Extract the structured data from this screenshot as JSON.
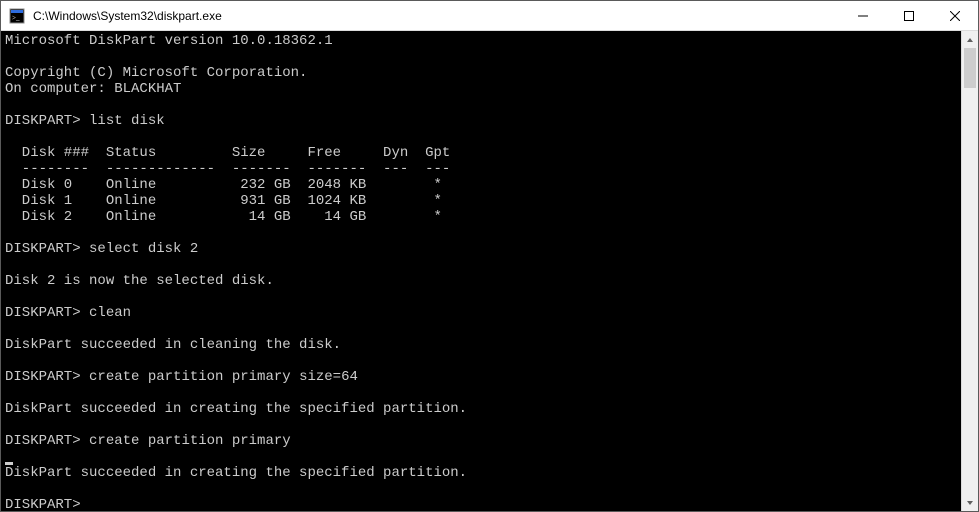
{
  "window": {
    "title": "C:\\Windows\\System32\\diskpart.exe"
  },
  "terminal": {
    "version_line": "Microsoft DiskPart version 10.0.18362.1",
    "copyright": "Copyright (C) Microsoft Corporation.",
    "computer_line": "On computer: BLACKHAT",
    "prompt": "DISKPART>",
    "cmd_list_disk": "list disk",
    "table": {
      "header": "  Disk ###  Status         Size     Free     Dyn  Gpt",
      "separator": "  --------  -------------  -------  -------  ---  ---",
      "rows": [
        "  Disk 0    Online          232 GB  2048 KB        *",
        "  Disk 1    Online          931 GB  1024 KB        *",
        "  Disk 2    Online           14 GB    14 GB        *"
      ]
    },
    "cmd_select": "select disk 2",
    "msg_selected": "Disk 2 is now the selected disk.",
    "cmd_clean": "clean",
    "msg_clean": "DiskPart succeeded in cleaning the disk.",
    "cmd_create1": "create partition primary size=64",
    "msg_create1": "DiskPart succeeded in creating the specified partition.",
    "cmd_create2": "create partition primary",
    "msg_create2": "DiskPart succeeded in creating the specified partition."
  }
}
